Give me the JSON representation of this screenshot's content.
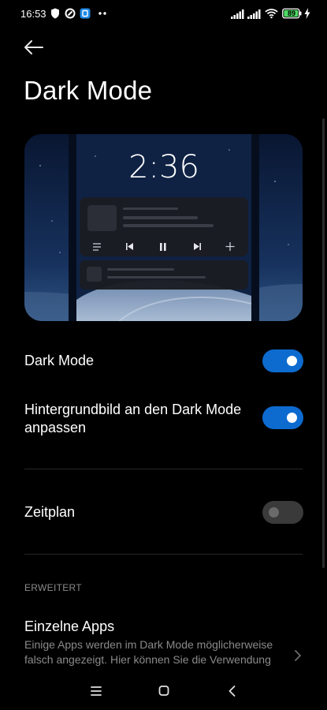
{
  "status_bar": {
    "time": "16:53",
    "battery_level": "89",
    "icons": [
      "shield-icon",
      "vpn-icon",
      "app-notification-icon",
      "more-dots-icon",
      "signal-icon",
      "signal-icon",
      "wifi-icon",
      "battery-icon",
      "charging-icon"
    ]
  },
  "header": {
    "back_icon": "arrow-left-icon",
    "title": "Dark Mode"
  },
  "preview": {
    "clock": "2:36",
    "media_controls": [
      "menu-icon",
      "previous-icon",
      "pause-icon",
      "next-icon",
      "plus-icon"
    ]
  },
  "settings": {
    "dark_mode": {
      "label": "Dark Mode",
      "enabled": true
    },
    "wallpaper": {
      "label_line1": "Hintergrundbild an den Dark Mode",
      "label_line2": "anpassen",
      "enabled": true
    },
    "schedule": {
      "label": "Zeitplan",
      "enabled": false
    }
  },
  "advanced": {
    "section_header": "ERWEITERT",
    "apps_title": "Einzelne Apps",
    "apps_description": "Einige Apps werden im Dark Mode möglicherweise falsch angezeigt. Hier können Sie die Verwendung des Dark Mode für einzelne Apps anpassen."
  },
  "nav_bar": {
    "icons": [
      "recents-icon",
      "home-icon",
      "back-icon"
    ]
  },
  "colors": {
    "background": "#000000",
    "toggle_on": "#0d6bd0",
    "toggle_off": "#3a3a3a",
    "secondary_text": "#8a8a8a"
  }
}
